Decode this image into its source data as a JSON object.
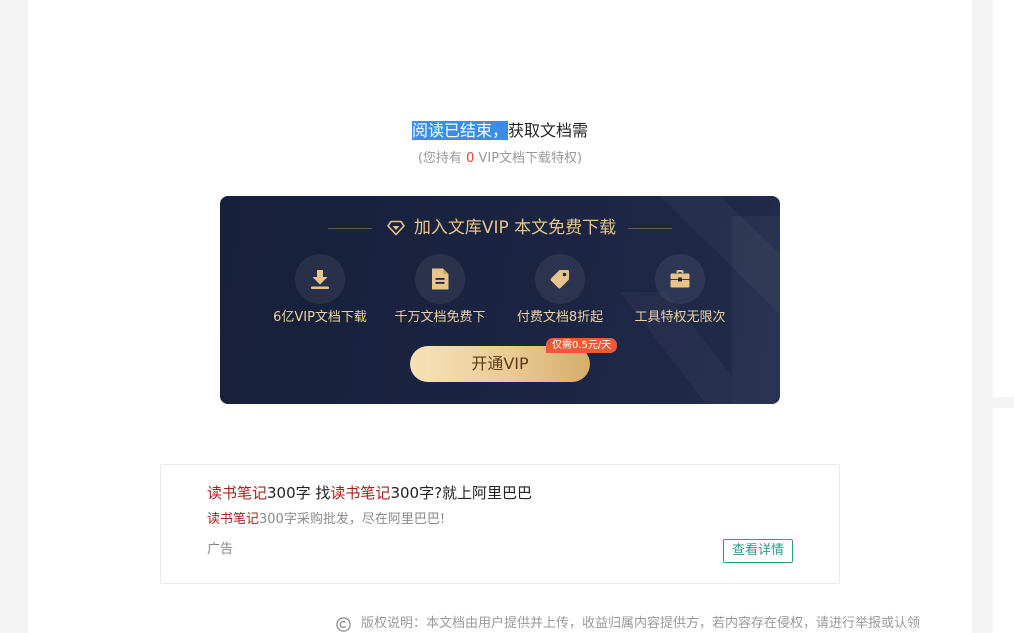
{
  "notice": {
    "highlighted_text": "阅读已结束，",
    "rest_text": "获取文档需",
    "privilege_prefix": "(您持有 ",
    "privilege_count": "0",
    "privilege_suffix": " VIP文档下载特权)"
  },
  "vip_card": {
    "title_icon": "diamond-icon",
    "title": "加入文库VIP 本文免费下载",
    "features": [
      {
        "icon": "download-icon",
        "label": "6亿VIP文档下载"
      },
      {
        "icon": "document-icon",
        "label": "千万文档免费下"
      },
      {
        "icon": "price-tag-icon",
        "label": "付费文档8折起"
      },
      {
        "icon": "toolbox-icon",
        "label": "工具特权无限次"
      }
    ],
    "cta_label": "开通VIP",
    "price_badge": "仅需0.5元/天"
  },
  "ad": {
    "title": [
      {
        "text": "读书笔记",
        "highlighted": true
      },
      {
        "text": "300字 找",
        "highlighted": false
      },
      {
        "text": "读书笔记",
        "highlighted": true
      },
      {
        "text": "300字?就上阿里巴巴",
        "highlighted": false
      }
    ],
    "description": [
      {
        "text": "读书笔记",
        "highlighted": true
      },
      {
        "text": "300字采购批发，尽在阿里巴巴!",
        "highlighted": false
      }
    ],
    "label": "广告",
    "details_button": "查看详情"
  },
  "copyright": {
    "icon": "copyright-icon",
    "text": "版权说明：本文档由用户提供并上传，收益归属内容提供方，若内容存在侵权，请进行举报或认领"
  },
  "colors": {
    "selection_highlight": "#3a8ee8",
    "privilege_count": "#e4432d",
    "vip_card_background": "#1b2441",
    "vip_gold": "#e6c48a",
    "price_badge": "#ea5a3b",
    "ad_keyword": "#a3231f",
    "details_button": "#2a9d8b"
  }
}
